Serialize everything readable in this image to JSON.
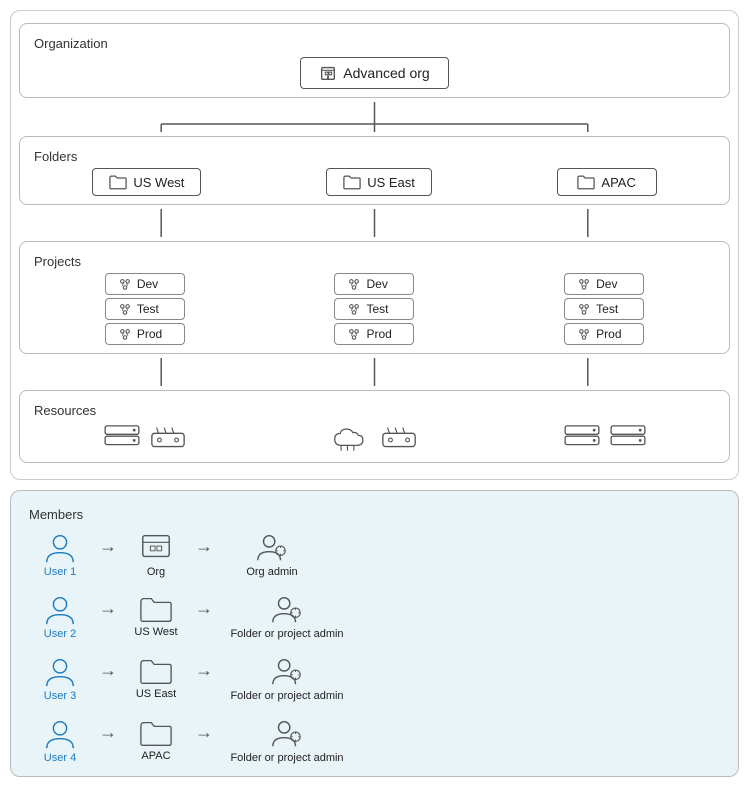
{
  "organization": {
    "label": "Organization",
    "org_name": "Advanced org"
  },
  "folders": {
    "label": "Folders",
    "items": [
      "US West",
      "US East",
      "APAC"
    ]
  },
  "projects": {
    "label": "Projects",
    "groups": [
      [
        "Dev",
        "Test",
        "Prod"
      ],
      [
        "Dev",
        "Test",
        "Prod"
      ],
      [
        "Dev",
        "Test",
        "Prod"
      ]
    ]
  },
  "resources": {
    "label": "Resources"
  },
  "members": {
    "label": "Members",
    "rows": [
      {
        "user": "User 1",
        "target": "Org",
        "role": "Org admin"
      },
      {
        "user": "User 2",
        "target": "US West",
        "role": "Folder or project admin"
      },
      {
        "user": "User 3",
        "target": "US East",
        "role": "Folder or project admin"
      },
      {
        "user": "User 4",
        "target": "APAC",
        "role": "Folder or project admin"
      }
    ]
  }
}
